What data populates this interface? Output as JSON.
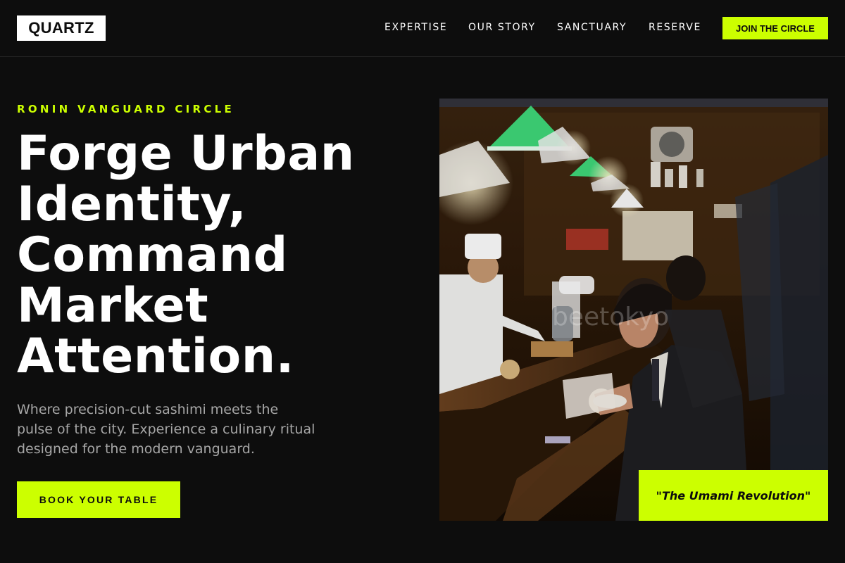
{
  "header": {
    "logo": "QUARTZ",
    "nav": [
      "EXPERTISE",
      "OUR STORY",
      "SANCTUARY",
      "RESERVE"
    ],
    "cta_label": "JOIN THE CIRCLE"
  },
  "hero": {
    "eyebrow": "RONIN VANGUARD CIRCLE",
    "headline_lines": [
      "Forge Urban",
      "Identity,",
      "Command",
      "Market",
      "Attention."
    ],
    "subtext_lines": [
      "Where precision-cut sashimi meets the",
      "pulse of the city. Experience a culinary ritual",
      "designed for the modern vanguard."
    ],
    "cta_label": "BOOK YOUR TABLE",
    "image_watermark": "beetokyo",
    "quote": "\"The Umami Revolution\""
  },
  "colors": {
    "accent": "#ccff00",
    "background": "#0d0d0d",
    "muted_text": "#a6a6a6"
  }
}
